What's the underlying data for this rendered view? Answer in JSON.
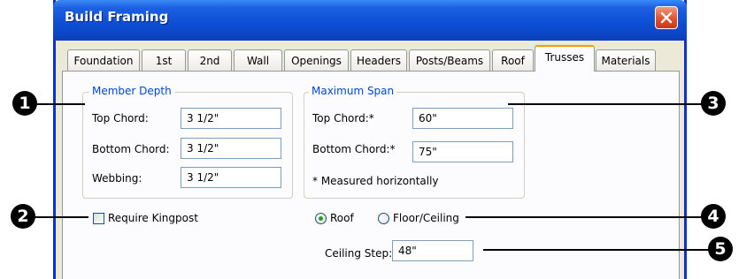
{
  "window": {
    "title": "Build Framing"
  },
  "tabs": [
    {
      "label": "Foundation"
    },
    {
      "label": "1st"
    },
    {
      "label": "2nd"
    },
    {
      "label": "Wall"
    },
    {
      "label": "Openings"
    },
    {
      "label": "Headers"
    },
    {
      "label": "Posts/Beams"
    },
    {
      "label": "Roof"
    },
    {
      "label": "Trusses"
    },
    {
      "label": "Materials"
    }
  ],
  "selected_tab": "Trusses",
  "member_depth": {
    "legend": "Member Depth",
    "top_chord_label": "Top Chord:",
    "top_chord_value": "3 1/2\"",
    "bottom_chord_label": "Bottom Chord:",
    "bottom_chord_value": "3 1/2\"",
    "webbing_label": "Webbing:",
    "webbing_value": "3 1/2\""
  },
  "maximum_span": {
    "legend": "Maximum Span",
    "top_chord_label": "Top Chord:*",
    "top_chord_value": "60\"",
    "bottom_chord_label": "Bottom Chord:*",
    "bottom_chord_value": "75\"",
    "note": "* Measured horizontally"
  },
  "require_kingpost": {
    "label": "Require Kingpost",
    "checked": false
  },
  "truss_type": {
    "options": [
      "Roof",
      "Floor/Ceiling"
    ],
    "selected": "Roof"
  },
  "ceiling_step": {
    "label": "Ceiling Step:",
    "value": "48\""
  },
  "callouts": [
    "1",
    "2",
    "3",
    "4",
    "5"
  ]
}
